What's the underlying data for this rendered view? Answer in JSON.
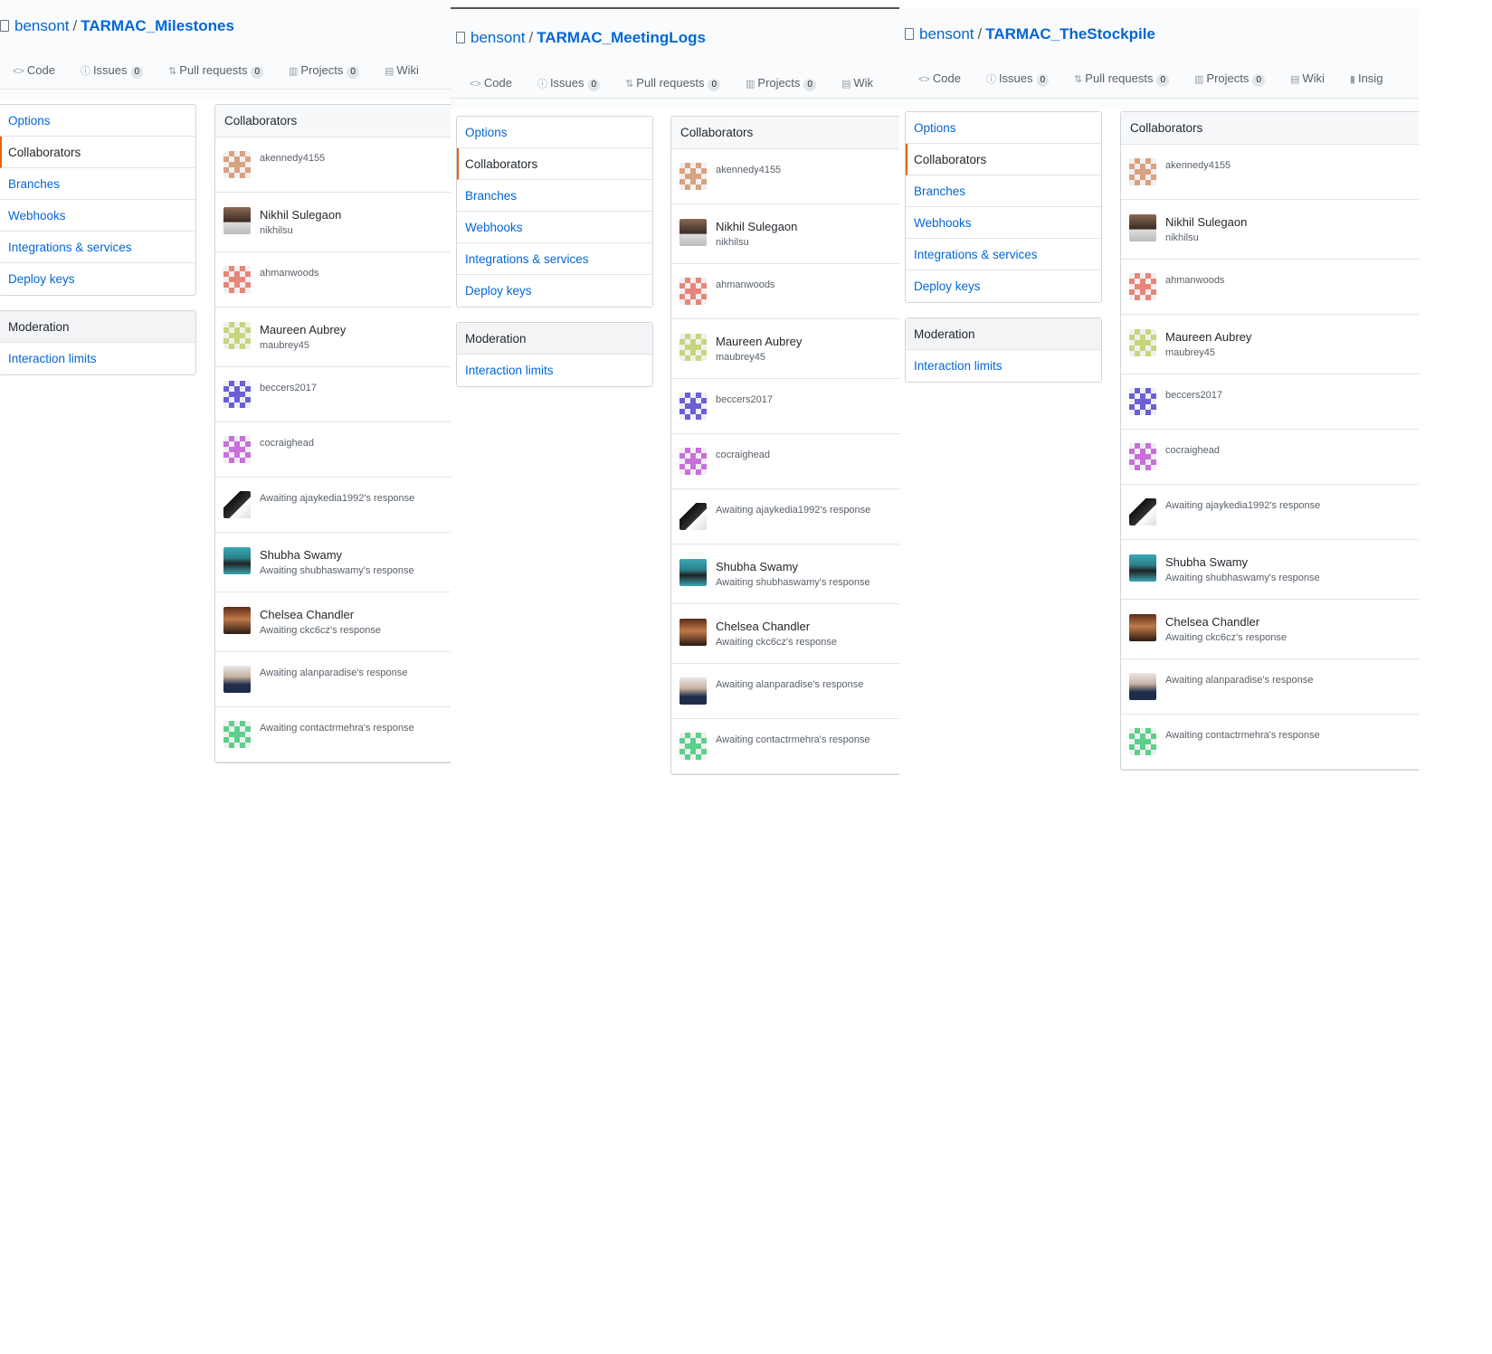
{
  "panels": [
    {
      "owner": "bensont",
      "repo": "TARMAC_Milestones",
      "tabs": [
        {
          "label": "Code",
          "icon": "code-icon"
        },
        {
          "label": "Issues",
          "count": "0",
          "icon": "issue-icon"
        },
        {
          "label": "Pull requests",
          "count": "0",
          "icon": "pull-request-icon"
        },
        {
          "label": "Projects",
          "count": "0",
          "icon": "project-icon"
        },
        {
          "label": "Wiki",
          "icon": "book-icon"
        }
      ]
    },
    {
      "owner": "bensont",
      "repo": "TARMAC_MeetingLogs",
      "tabs": [
        {
          "label": "Code",
          "icon": "code-icon"
        },
        {
          "label": "Issues",
          "count": "0",
          "icon": "issue-icon"
        },
        {
          "label": "Pull requests",
          "count": "0",
          "icon": "pull-request-icon"
        },
        {
          "label": "Projects",
          "count": "0",
          "icon": "project-icon"
        },
        {
          "label": "Wik",
          "icon": "book-icon"
        }
      ]
    },
    {
      "owner": "bensont",
      "repo": "TARMAC_TheStockpile",
      "tabs": [
        {
          "label": "Code",
          "icon": "code-icon"
        },
        {
          "label": "Issues",
          "count": "0",
          "icon": "issue-icon"
        },
        {
          "label": "Pull requests",
          "count": "0",
          "icon": "pull-request-icon"
        },
        {
          "label": "Projects",
          "count": "0",
          "icon": "project-icon"
        },
        {
          "label": "Wiki",
          "icon": "book-icon"
        },
        {
          "label": "Insig",
          "icon": "graph-icon"
        }
      ]
    }
  ],
  "menu": {
    "items": [
      "Options",
      "Collaborators",
      "Branches",
      "Webhooks",
      "Integrations & services",
      "Deploy keys"
    ],
    "selected": "Collaborators",
    "moderation_header": "Moderation",
    "moderation_items": [
      "Interaction limits"
    ]
  },
  "collaborators": {
    "header": "Collaborators",
    "rows": [
      {
        "kind": "single",
        "text": "akennedy4155",
        "avatar": "identicon",
        "color": "#d9a27f"
      },
      {
        "kind": "double",
        "name": "Nikhil Sulegaon",
        "sub": "nikhilsu",
        "avatar": "photo"
      },
      {
        "kind": "single",
        "text": "ahmanwoods",
        "avatar": "identicon",
        "color": "#e8857a"
      },
      {
        "kind": "double",
        "name": "Maureen Aubrey",
        "sub": "maubrey45",
        "avatar": "identicon",
        "color": "#c6d67a"
      },
      {
        "kind": "single",
        "text": "beccers2017",
        "avatar": "identicon",
        "color": "#6a5fd6"
      },
      {
        "kind": "single",
        "text": "cocraighead",
        "avatar": "identicon",
        "color": "#c86fdb"
      },
      {
        "kind": "single",
        "text": "Awaiting ajaykedia1992's response",
        "avatar": "photo-bw"
      },
      {
        "kind": "double",
        "name": "Shubha Swamy",
        "sub": "Awaiting shubhaswamy's response",
        "avatar": "photo-teal"
      },
      {
        "kind": "double",
        "name": "Chelsea Chandler",
        "sub": "Awaiting ckc6cz's response",
        "avatar": "photo-warm"
      },
      {
        "kind": "single",
        "text": "Awaiting alanparadise's response",
        "avatar": "photo-suit"
      },
      {
        "kind": "single",
        "text": "Awaiting contactrmehra's response",
        "avatar": "identicon",
        "color": "#5cd08a"
      }
    ]
  }
}
